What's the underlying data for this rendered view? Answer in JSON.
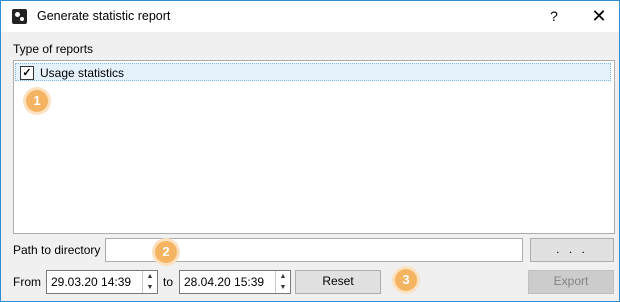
{
  "window": {
    "title": "Generate statistic report",
    "help_label": "?",
    "close_label": "✕",
    "accent_color": "#2b8fd6"
  },
  "reports": {
    "label": "Type of reports",
    "items": [
      {
        "label": "Usage statistics",
        "checked": true,
        "check_glyph": "✓"
      }
    ]
  },
  "path": {
    "label": "Path to directory",
    "value": "",
    "browse_label": ". . ."
  },
  "dates": {
    "from_label": "From",
    "from_value": "29.03.20 14:39",
    "to_label": "to",
    "to_value": "28.04.20 15:39"
  },
  "buttons": {
    "reset_label": "Reset",
    "export_label": "Export",
    "export_enabled": false
  },
  "callouts": {
    "one": "1",
    "two": "2",
    "three": "3",
    "color": "#f5b461"
  }
}
